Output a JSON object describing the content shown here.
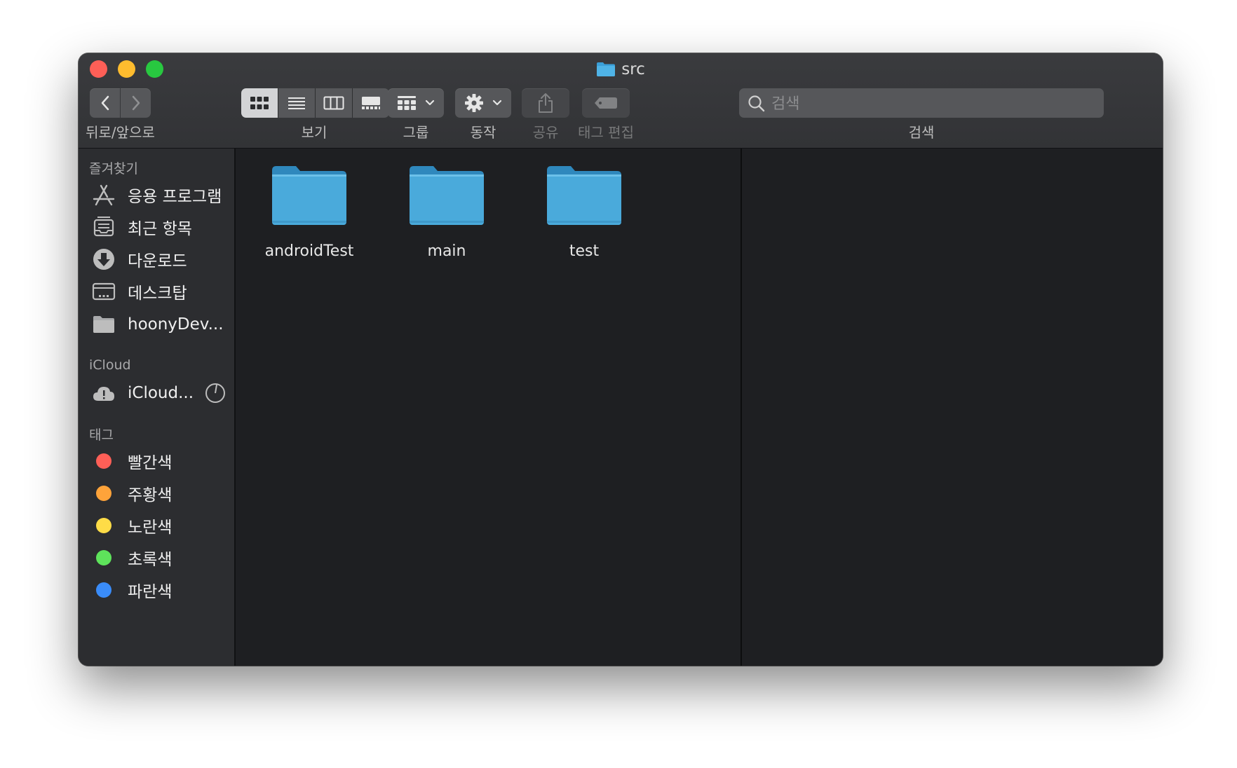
{
  "window": {
    "title": "src"
  },
  "toolbar": {
    "nav_label": "뒤로/앞으로",
    "view_label": "보기",
    "group_label": "그룹",
    "action_label": "동작",
    "share_label": "공유",
    "tags_label": "태그 편집",
    "search_label": "검색",
    "search_placeholder": "검색"
  },
  "sidebar": {
    "favorites_header": "즐겨찾기",
    "favorites": [
      {
        "label": "응용 프로그램",
        "icon": "applications-icon"
      },
      {
        "label": "최근 항목",
        "icon": "recents-icon"
      },
      {
        "label": "다운로드",
        "icon": "downloads-icon"
      },
      {
        "label": "데스크탑",
        "icon": "desktop-icon"
      },
      {
        "label": "hoonyDev...",
        "icon": "folder-icon"
      }
    ],
    "icloud_header": "iCloud",
    "icloud": [
      {
        "label": "iCloud...",
        "icon": "icloud-icon"
      }
    ],
    "tags_header": "태그",
    "tags": [
      {
        "label": "빨간색",
        "color": "#fe5f57"
      },
      {
        "label": "주황색",
        "color": "#fea33a"
      },
      {
        "label": "노란색",
        "color": "#fedc47"
      },
      {
        "label": "초록색",
        "color": "#5ee35b"
      },
      {
        "label": "파란색",
        "color": "#3a8cf9"
      }
    ]
  },
  "files": [
    {
      "name": "androidTest"
    },
    {
      "name": "main"
    },
    {
      "name": "test"
    }
  ]
}
